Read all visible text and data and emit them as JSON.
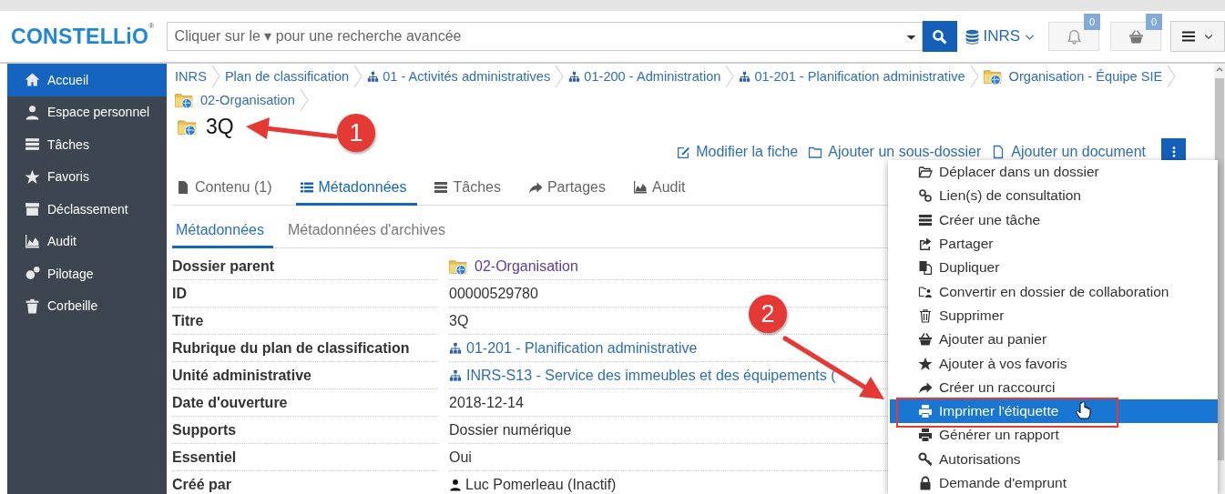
{
  "header": {
    "logo": "CONSTELLiO$^{®}$",
    "search": {
      "placeholder": "Cliquer sur le ▾ pour une recherche avancée"
    },
    "collection": "INRS",
    "notifications": "0",
    "cart": "0"
  },
  "sidebar": {
    "items": [
      {
        "label": "Accueil",
        "selected": true
      },
      {
        "label": "Espace personnel",
        "selected": false
      },
      {
        "label": "Tâches",
        "selected": false
      },
      {
        "label": "Favoris",
        "selected": false
      },
      {
        "label": "Déclassement",
        "selected": false
      },
      {
        "label": "Audit",
        "selected": false
      },
      {
        "label": "Pilotage",
        "selected": false
      },
      {
        "label": "Corbeille",
        "selected": false
      }
    ]
  },
  "breadcrumb": [
    {
      "label": "INRS",
      "kind": "plain"
    },
    {
      "label": "Plan de classification",
      "kind": "plain"
    },
    {
      "label": "01 - Activités administratives",
      "kind": "tree"
    },
    {
      "label": "01-200 - Administration",
      "kind": "tree"
    },
    {
      "label": "01-201 - Planification administrative",
      "kind": "tree"
    },
    {
      "label": "Organisation - Équipe SIE",
      "kind": "folder"
    },
    {
      "label": "02-Organisation",
      "kind": "folder"
    }
  ],
  "title": "3Q",
  "actions": [
    "Modifier la fiche",
    "Ajouter un sous-dossier",
    "Ajouter un document"
  ],
  "tabs": [
    {
      "label": "Contenu (1)",
      "selected": false
    },
    {
      "label": "Métadonnées",
      "selected": true
    },
    {
      "label": "Tâches",
      "selected": false
    },
    {
      "label": "Partages",
      "selected": false
    },
    {
      "label": "Audit",
      "selected": false
    }
  ],
  "subtabs": [
    {
      "label": "Métadonnées",
      "selected": true
    },
    {
      "label": "Métadonnées d'archives",
      "selected": false
    }
  ],
  "metadata": [
    {
      "label": "Dossier parent",
      "value": "02-Organisation",
      "kind": "folder-link"
    },
    {
      "label": "ID",
      "value": "00000529780",
      "kind": "text"
    },
    {
      "label": "Titre",
      "value": "3Q",
      "kind": "text"
    },
    {
      "label": "Rubrique du plan de classification",
      "value": "01-201 - Planification administrative",
      "kind": "tree-link"
    },
    {
      "label": "Unité administrative",
      "value": "INRS-S13 - Service des immeubles et des équipements (",
      "kind": "tree-link"
    },
    {
      "label": "Date d'ouverture",
      "value": "2018-12-14",
      "kind": "text"
    },
    {
      "label": "Supports",
      "value": "Dossier numérique",
      "kind": "text"
    },
    {
      "label": "Essentiel",
      "value": "Oui",
      "kind": "text"
    },
    {
      "label": "Créé par",
      "value": "Luc Pomerleau (Inactif)",
      "kind": "user"
    }
  ],
  "menu": {
    "items": [
      {
        "label": "Déplacer dans un dossier",
        "selected": false
      },
      {
        "label": "Lien(s) de consultation",
        "selected": false
      },
      {
        "label": "Créer une tâche",
        "selected": false
      },
      {
        "label": "Partager",
        "selected": false
      },
      {
        "label": "Dupliquer",
        "selected": false
      },
      {
        "label": "Convertir en dossier de collaboration",
        "selected": false
      },
      {
        "label": "Supprimer",
        "selected": false
      },
      {
        "label": "Ajouter au panier",
        "selected": false
      },
      {
        "label": "Ajouter à vos favoris",
        "selected": false
      },
      {
        "label": "Créer un raccourci",
        "selected": false
      },
      {
        "label": "Imprimer l'étiquette",
        "selected": true
      },
      {
        "label": "Générer un rapport",
        "selected": false
      },
      {
        "label": "Autorisations",
        "selected": false
      },
      {
        "label": "Demande d'emprunt",
        "selected": false
      }
    ]
  },
  "annotations": {
    "steps": [
      {
        "number": "1"
      },
      {
        "number": "2"
      }
    ]
  }
}
